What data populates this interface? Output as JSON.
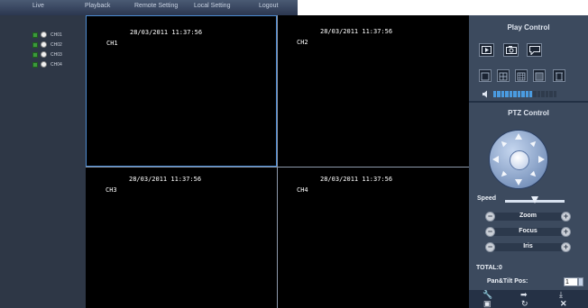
{
  "nav": {
    "items": [
      "Live",
      "Playback",
      "Remote Setting",
      "Local Setting",
      "Logout"
    ]
  },
  "channels": [
    "CH01",
    "CH02",
    "CH03",
    "CH04"
  ],
  "video": {
    "cells": [
      {
        "timestamp": "28/03/2011 11:37:56",
        "channel": "CH1"
      },
      {
        "timestamp": "28/03/2011 11:37:56",
        "channel": "CH2"
      },
      {
        "timestamp": "28/03/2011 11:37:56",
        "channel": "CH3"
      },
      {
        "timestamp": "28/03/2011 11:37:56",
        "channel": "CH4"
      }
    ]
  },
  "play_control": {
    "title": "Play Control",
    "icons": [
      "play-icon",
      "snapshot-icon",
      "talk-icon"
    ],
    "split_icons": [
      "split-1-icon",
      "split-4-icon",
      "split-9-icon",
      "split-16-icon",
      "fullscreen-icon"
    ],
    "volume_level": 0.6
  },
  "ptz": {
    "title": "PTZ Control",
    "speed_label": "Speed",
    "speed_level": 0.5,
    "zoom_label": "Zoom",
    "focus_label": "Focus",
    "iris_label": "Iris",
    "total_label": "TOTAL:0",
    "pan_tilt_label": "Pan&Tilt Pos:",
    "pan_tilt_value": "1"
  },
  "bottom_icons": [
    "wrench-icon",
    "arrow-right-icon",
    "download-icon",
    "save-icon",
    "loop-icon",
    "close-icon"
  ],
  "colors": {
    "accent_blue": "#4d8bd1",
    "panel_bg": "#3c4a5e",
    "nav_bg": "#2b3750"
  }
}
